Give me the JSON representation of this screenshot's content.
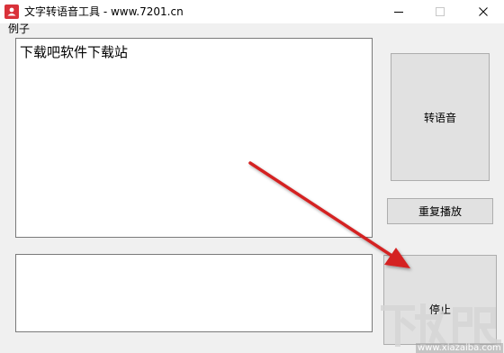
{
  "window": {
    "title": "文字转语音工具 - www.7201.cn",
    "icon": "app-icon"
  },
  "menu": {
    "items": [
      {
        "label": "例子"
      }
    ]
  },
  "main_text": {
    "value": "下载吧软件下载站"
  },
  "secondary_text": {
    "value": ""
  },
  "buttons": {
    "convert": "转语音",
    "replay": "重复播放",
    "stop": "停止"
  },
  "annotation": {
    "arrow_color": "#d42020",
    "icon": "red-arrow-icon"
  },
  "watermark": {
    "text": "下载吧",
    "site": "www.xiazaiba.com"
  },
  "colors": {
    "titlebar": "#ffffff",
    "window_bg": "#f0f0f0",
    "button_bg": "#e1e1e1",
    "button_border": "#adadad",
    "icon_red": "#d9323a"
  }
}
